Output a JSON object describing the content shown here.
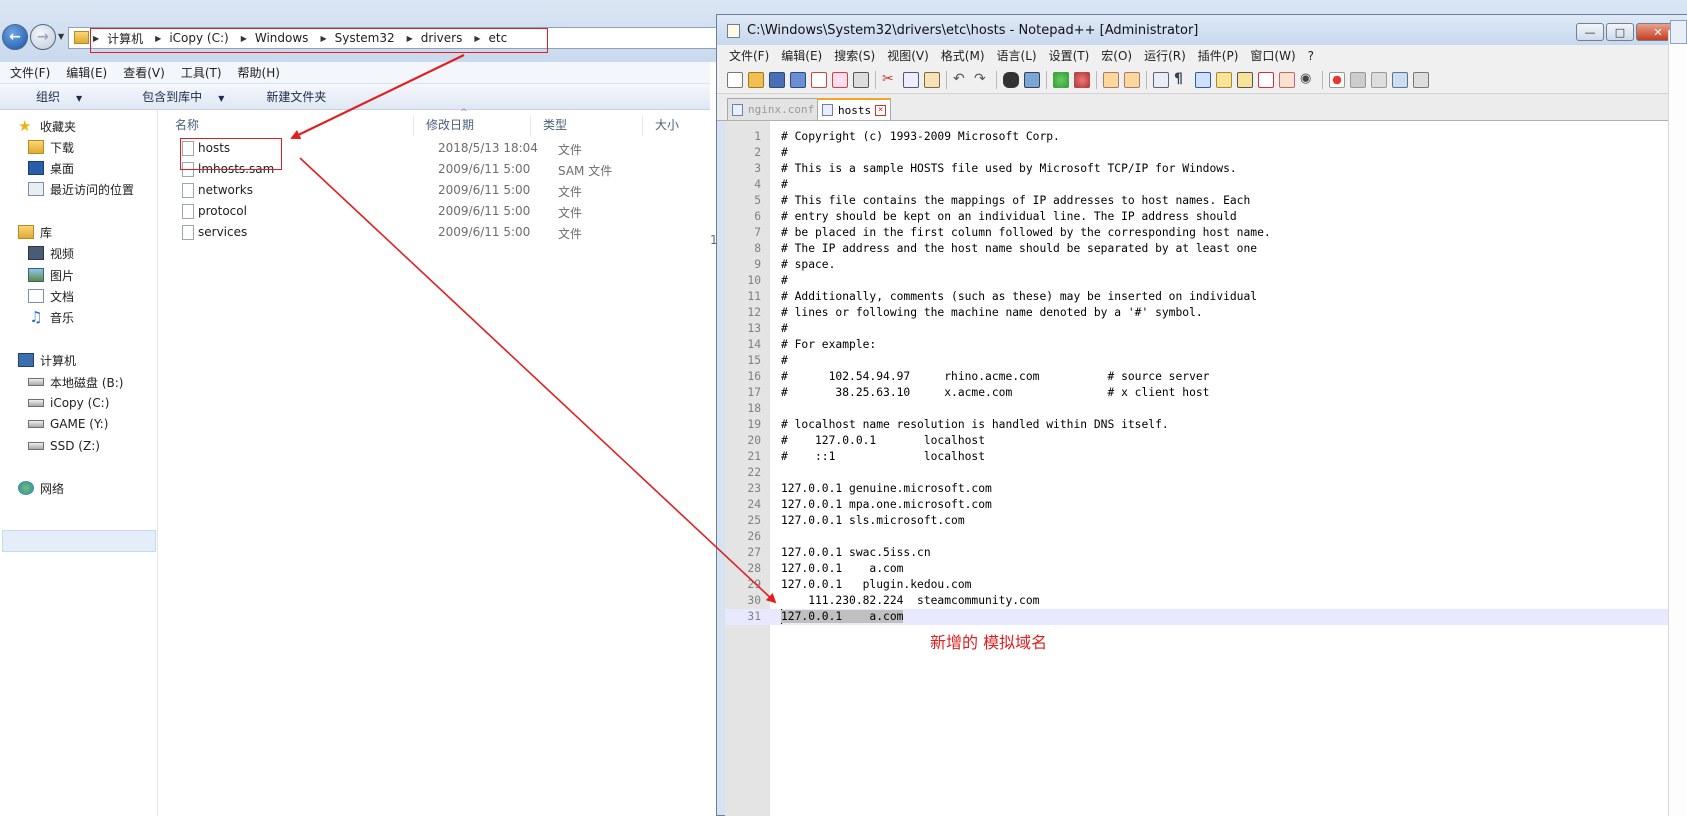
{
  "explorer": {
    "address": [
      "计算机",
      "iCopy (C:)",
      "Windows",
      "System32",
      "drivers",
      "etc"
    ],
    "menu": [
      "文件(F)",
      "编辑(E)",
      "查看(V)",
      "工具(T)",
      "帮助(H)"
    ],
    "commands": {
      "organize": "组织",
      "include": "包含到库中",
      "new_folder": "新建文件夹"
    },
    "nav": {
      "favorites": "收藏夹",
      "downloads": "下载",
      "desktop": "桌面",
      "recent": "最近访问的位置",
      "libraries": "库",
      "videos": "视频",
      "pictures": "图片",
      "documents": "文档",
      "music": "音乐",
      "computer": "计算机",
      "drive_b": "本地磁盘 (B:)",
      "drive_c": "iCopy (C:)",
      "drive_y": "GAME (Y:)",
      "drive_z": "SSD (Z:)",
      "network": "网络"
    },
    "columns": {
      "name": "名称",
      "date": "修改日期",
      "type": "类型",
      "size": "大小"
    },
    "files": [
      {
        "name": "hosts",
        "date": "2018/5/13 18:04",
        "type": "文件"
      },
      {
        "name": "lmhosts.sam",
        "date": "2009/6/11 5:00",
        "type": "SAM 文件"
      },
      {
        "name": "networks",
        "date": "2009/6/11 5:00",
        "type": "文件"
      },
      {
        "name": "protocol",
        "date": "2009/6/11 5:00",
        "type": "文件"
      },
      {
        "name": "services",
        "date": "2009/6/11 5:00",
        "type": "文件"
      }
    ],
    "truncated_size": "1"
  },
  "npp": {
    "title": "C:\\Windows\\System32\\drivers\\etc\\hosts - Notepad++ [Administrator]",
    "menu": [
      "文件(F)",
      "编辑(E)",
      "搜索(S)",
      "视图(V)",
      "格式(M)",
      "语言(L)",
      "设置(T)",
      "宏(O)",
      "运行(R)",
      "插件(P)",
      "窗口(W)",
      "?"
    ],
    "menu_close": "X",
    "tabs": [
      "nginx.conf",
      "hosts"
    ],
    "lines": [
      "# Copyright (c) 1993-2009 Microsoft Corp.",
      "#",
      "# This is a sample HOSTS file used by Microsoft TCP/IP for Windows.",
      "#",
      "# This file contains the mappings of IP addresses to host names. Each",
      "# entry should be kept on an individual line. The IP address should",
      "# be placed in the first column followed by the corresponding host name.",
      "# The IP address and the host name should be separated by at least one",
      "# space.",
      "#",
      "# Additionally, comments (such as these) may be inserted on individual",
      "# lines or following the machine name denoted by a '#' symbol.",
      "#",
      "# For example:",
      "#",
      "#      102.54.94.97     rhino.acme.com          # source server",
      "#       38.25.63.10     x.acme.com              # x client host",
      "",
      "# localhost name resolution is handled within DNS itself.",
      "#\t127.0.0.1       localhost",
      "#\t::1             localhost",
      "",
      "127.0.0.1 genuine.microsoft.com",
      "127.0.0.1 mpa.one.microsoft.com",
      "127.0.0.1 sls.microsoft.com",
      "",
      "127.0.0.1 swac.5iss.cn",
      "127.0.0.1    a.com",
      "127.0.0.1   plugin.kedou.com",
      "    111.230.82.224  steamcommunity.com",
      "127.0.0.1    a.com"
    ],
    "current_line": 31
  },
  "annotation": "新增的 模拟域名",
  "colors": {
    "annotation_red": "#e02020",
    "current_line_bg": "#e8e8ff"
  }
}
